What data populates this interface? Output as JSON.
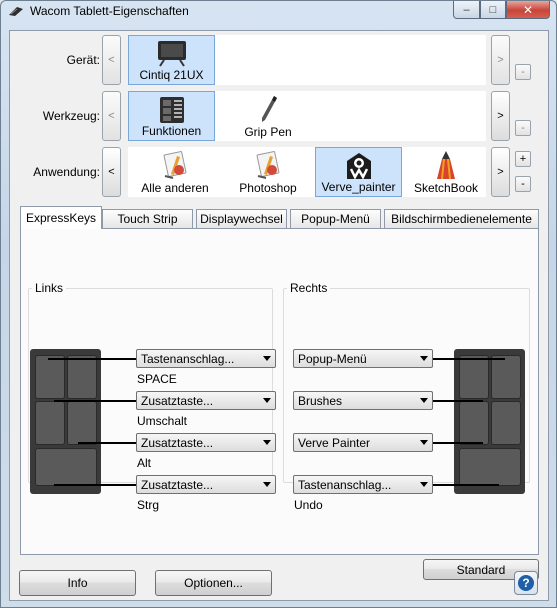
{
  "window": {
    "title": "Wacom Tablett-Eigenschaften",
    "minimize": "–",
    "maximize": "□",
    "close": "✕"
  },
  "device": {
    "label": "Gerät:",
    "items": [
      {
        "label": "Cintiq 21UX",
        "icon": "monitor-icon",
        "selected": true
      }
    ]
  },
  "tool": {
    "label": "Werkzeug:",
    "items": [
      {
        "label": "Funktionen",
        "icon": "functions-icon",
        "selected": true
      },
      {
        "label": "Grip Pen",
        "icon": "pen-icon",
        "selected": false
      }
    ]
  },
  "application": {
    "label": "Anwendung:",
    "items": [
      {
        "label": "Alle anderen",
        "icon": "apps-icon",
        "selected": false
      },
      {
        "label": "Photoshop",
        "icon": "apps-icon",
        "selected": false
      },
      {
        "label": "Verve_painter",
        "icon": "verve-icon",
        "selected": true
      },
      {
        "label": "SketchBook",
        "icon": "pencil-icon",
        "selected": false
      }
    ]
  },
  "nav": {
    "prev": "<",
    "next": ">",
    "add": "+",
    "remove": "-"
  },
  "tabs": [
    {
      "label": "ExpressKeys",
      "active": true
    },
    {
      "label": "Touch Strip",
      "active": false
    },
    {
      "label": "Displaywechsel",
      "active": false
    },
    {
      "label": "Popup-Menü",
      "active": false
    },
    {
      "label": "Bildschirmbedienelemente",
      "active": false
    }
  ],
  "expresskeys": {
    "left": {
      "label": "Links",
      "keys": [
        {
          "value": "Tastenanschlag...",
          "sub": "SPACE"
        },
        {
          "value": "Zusatztaste...",
          "sub": "Umschalt"
        },
        {
          "value": "Zusatztaste...",
          "sub": "Alt"
        },
        {
          "value": "Zusatztaste...",
          "sub": "Strg"
        }
      ]
    },
    "right": {
      "label": "Rechts",
      "keys": [
        {
          "value": "Popup-Menü",
          "sub": ""
        },
        {
          "value": "Brushes",
          "sub": ""
        },
        {
          "value": "Verve Painter",
          "sub": ""
        },
        {
          "value": "Tastenanschlag...",
          "sub": "Undo"
        }
      ]
    },
    "default_button": "Standard"
  },
  "footer": {
    "info": "Info",
    "options": "Optionen...",
    "help": "?"
  },
  "colors": {
    "selection": "#cde3fb",
    "selection_border": "#7aa7d9",
    "help_accent": "#1f5fa8"
  }
}
